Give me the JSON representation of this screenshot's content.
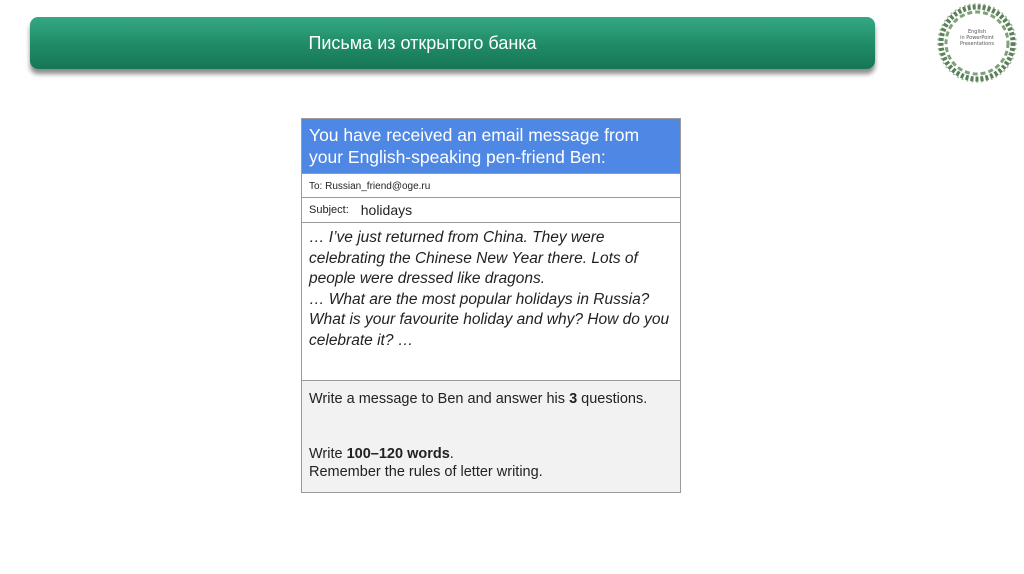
{
  "banner": {
    "title": "Письма из открытого банка"
  },
  "logo": {
    "line1": "English",
    "line2": "in PowerPoint",
    "line3": "Presentations"
  },
  "email": {
    "header": "You have received an email message from your English-speaking pen-friend Ben:",
    "to": "To: Russian_friend@oge.ru",
    "subject_label": "Subject:",
    "subject_value": "holidays",
    "body_line1": "… I’ve just returned from China. They were celebrating the Chinese New Year there. Lots of people were dressed like dragons.",
    "body_line2": "… What are the most popular holidays in Russia? What is your favourite holiday and why? How do you celebrate it? …"
  },
  "task": {
    "line1_pre": "Write a message to Ben and answer his ",
    "line1_bold": "3",
    "line1_post": " questions.",
    "line2_pre": "Write ",
    "line2_bold": "100–120 words",
    "line2_post": ".",
    "line3": "Remember the rules of letter writing."
  }
}
